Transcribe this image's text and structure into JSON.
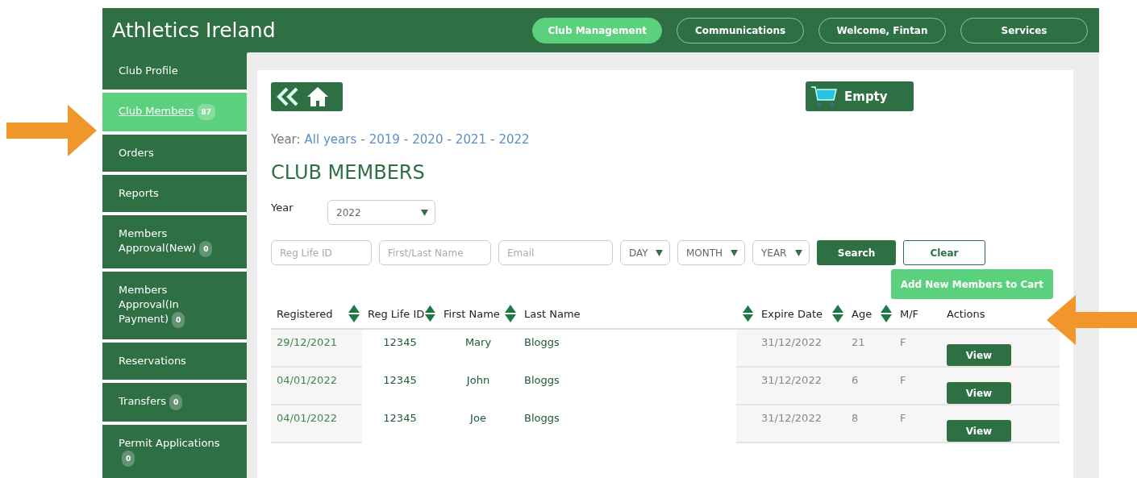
{
  "header": {
    "title": "Athletics Ireland",
    "nav": [
      {
        "label": "Club Management",
        "selected": true
      },
      {
        "label": "Communications",
        "selected": false
      },
      {
        "label": "Welcome, Fintan",
        "selected": false
      },
      {
        "label": "Services",
        "selected": false
      }
    ]
  },
  "sidebar": {
    "items": [
      {
        "label": "Club Profile",
        "selected": false
      },
      {
        "label": "Club Members",
        "badge": "87",
        "selected": true
      },
      {
        "label": "Orders",
        "selected": false
      },
      {
        "label": "Reports",
        "selected": false
      },
      {
        "label": "Members Approval(New)",
        "badge": "0",
        "selected": false
      },
      {
        "label": "Members Approval(In Payment)",
        "badge": "0",
        "selected": false
      },
      {
        "label": "Reservations",
        "selected": false
      },
      {
        "label": "Transfers",
        "badge": "0",
        "selected": false
      },
      {
        "label": "Permit Applications",
        "badge": "0",
        "selected": false
      }
    ]
  },
  "cart": {
    "label": "Empty"
  },
  "year_links": {
    "label": "Year:",
    "separator": "-",
    "links": [
      "All years",
      "2019",
      "2020",
      "2021",
      "2022"
    ]
  },
  "heading": "CLUB MEMBERS",
  "year_select": {
    "label": "Year",
    "value": "2022"
  },
  "filters": {
    "fields": [
      {
        "placeholder": "Reg Life ID"
      },
      {
        "placeholder": "First/Last Name"
      },
      {
        "placeholder": "Email"
      }
    ],
    "selects": [
      "DAY",
      "MONTH",
      "YEAR"
    ],
    "search_button": "Search",
    "clear_button": "Clear"
  },
  "add_button": "Add New Members to Cart",
  "table": {
    "columns": [
      {
        "label": "Registered",
        "sortable": true
      },
      {
        "label": "Reg Life ID",
        "sortable": true
      },
      {
        "label": "First Name",
        "sortable": true
      },
      {
        "label": "Last Name",
        "sortable": false
      },
      {
        "sortable": true
      },
      {
        "label": "Expire Date",
        "sortable": true
      },
      {
        "label": "Age",
        "sortable": true
      },
      {
        "label": "M/F",
        "sortable": false
      },
      {
        "label": "Actions",
        "sortable": false
      }
    ],
    "rows": [
      {
        "registered": "29/12/2021",
        "reg_life_id": "12345",
        "first_name": "Mary",
        "last_name": "Bloggs",
        "expire_date": "31/12/2022",
        "age": "21",
        "sex": "F",
        "action": "View"
      },
      {
        "registered": "04/01/2022",
        "reg_life_id": "12345",
        "first_name": "John",
        "last_name": "Bloggs",
        "expire_date": "31/12/2022",
        "age": "6",
        "sex": "F",
        "action": "View"
      },
      {
        "registered": "04/01/2022",
        "reg_life_id": "12345",
        "first_name": "Joe",
        "last_name": "Bloggs",
        "expire_date": "31/12/2022",
        "age": "8",
        "sex": "F",
        "action": "View"
      }
    ]
  }
}
